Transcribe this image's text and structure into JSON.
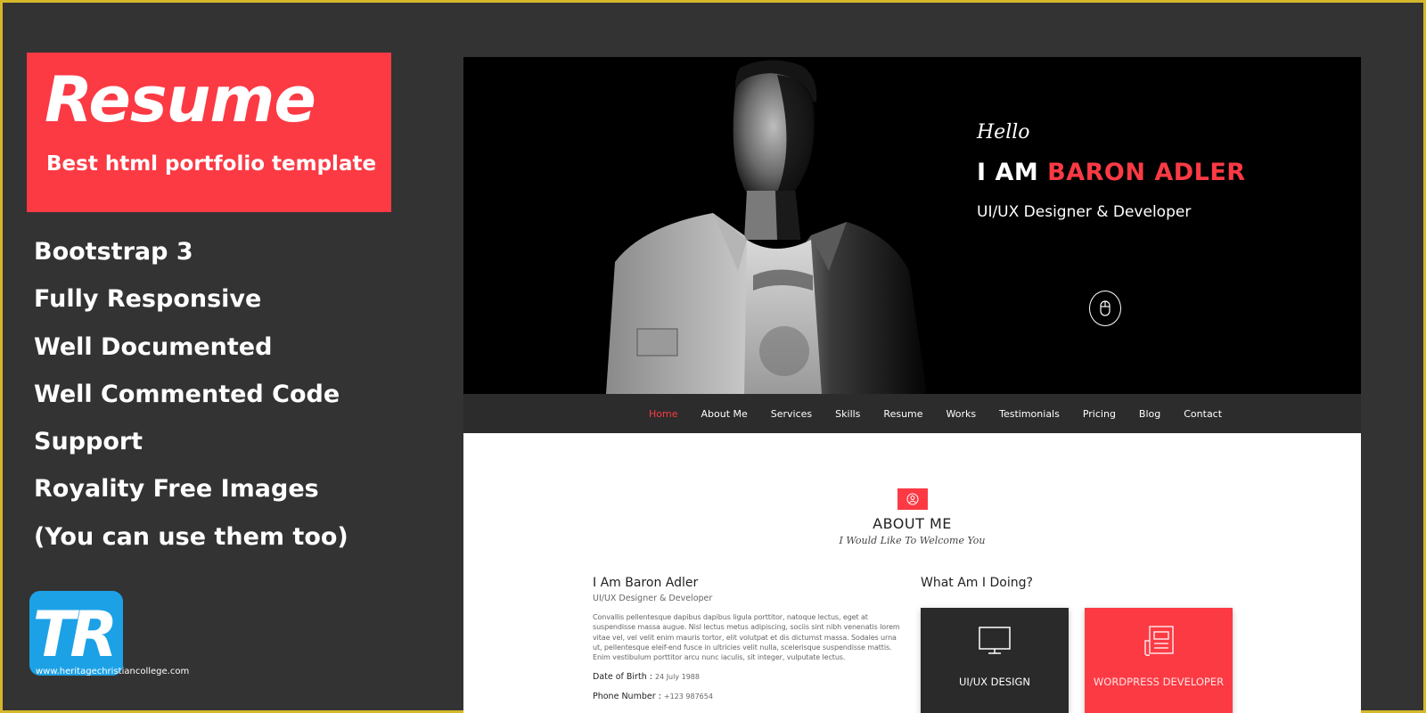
{
  "colors": {
    "accent": "#fc3a44",
    "frame_border": "#d4b82a",
    "background": "#333333",
    "logo_blue": "#1da1e6"
  },
  "promo": {
    "title": "Resume",
    "subtitle": "Best html portfolio template",
    "features": [
      "Bootstrap 3",
      "Fully Responsive",
      "Well Documented",
      "Well Commented Code",
      "Support",
      "Royality Free Images",
      "(You can use them too)"
    ],
    "logo_text": "TR",
    "watermark": "www.heritagechristiancollege.com"
  },
  "site": {
    "hero": {
      "greeting": "Hello",
      "name_prefix": "I AM",
      "name": "BARON ADLER",
      "role": "UI/UX Designer & Developer",
      "scroll_icon": "mouse-scroll-icon"
    },
    "nav": {
      "items": [
        {
          "label": "Home",
          "active": true
        },
        {
          "label": "About Me",
          "active": false
        },
        {
          "label": "Services",
          "active": false
        },
        {
          "label": "Skills",
          "active": false
        },
        {
          "label": "Resume",
          "active": false
        },
        {
          "label": "Works",
          "active": false
        },
        {
          "label": "Testimonials",
          "active": false
        },
        {
          "label": "Pricing",
          "active": false
        },
        {
          "label": "Blog",
          "active": false
        },
        {
          "label": "Contact",
          "active": false
        }
      ]
    },
    "about": {
      "icon": "user-icon",
      "title": "ABOUT ME",
      "tagline": "I Would Like To Welcome You",
      "bio_name": "I Am Baron Adler",
      "bio_role": "UI/UX Designer & Developer",
      "bio_text": "Convallis pellentesque dapibus dapibus ligula porttitor, natoque lectus, eget at suspendisse massa augue. Nisl lectus metus adipiscing, sociis sint nibh venenatis lorem vitae vel, vel velit enim mauris tortor, elit volutpat et dis dictumst massa. Sodales urna ut, pellentesque eleif-end fusce in ultricies velit nulla, scelerisque suspendisse mattis. Enim vestibulum porttitor arcu nunc iaculis, sit integer, vulputate lectus.",
      "fields": [
        {
          "label": "Date of Birth :",
          "value": "24 July 1988"
        },
        {
          "label": "Phone Number :",
          "value": "+123 987654"
        }
      ],
      "doing_title": "What Am I Doing?",
      "services": [
        {
          "label": "UI/UX DESIGN",
          "icon": "monitor-icon",
          "style": "dark"
        },
        {
          "label": "WORDPRESS DEVELOPER",
          "icon": "newspaper-icon",
          "style": "red"
        }
      ]
    }
  }
}
